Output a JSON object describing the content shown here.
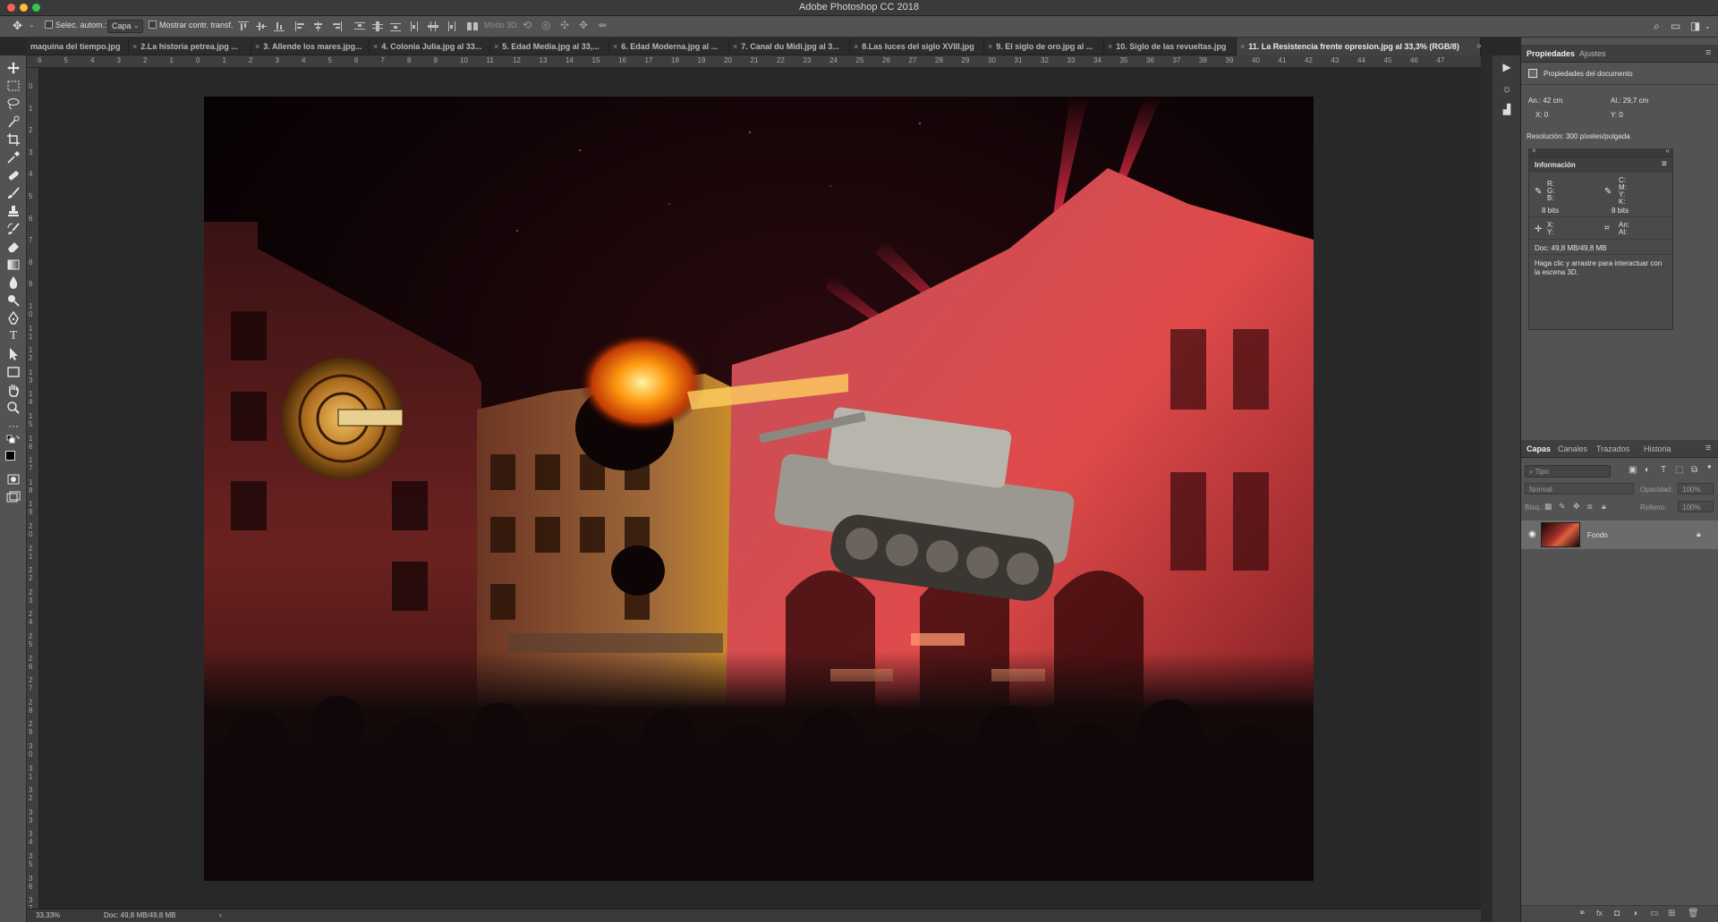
{
  "window": {
    "title": "Adobe Photoshop CC 2018",
    "traffic_colors": [
      "#fc605c",
      "#fdbc40",
      "#34c84a"
    ]
  },
  "options_bar": {
    "auto_select_label": "Selec. autom.:",
    "auto_select_value": "Capa",
    "show_transform_label": "Mostrar contr. transf.",
    "mode_3d_label": "Modo 3D:"
  },
  "tabs": [
    {
      "label": "maquina del tiempo.jpg",
      "close": ""
    },
    {
      "label": "2.La historia petrea.jpg ...",
      "close": "×"
    },
    {
      "label": "3. Allende los mares.jpg...",
      "close": "×"
    },
    {
      "label": "4. Colonia Julia.jpg al 33...",
      "close": "×"
    },
    {
      "label": "5. Edad Media.jpg al 33,...",
      "close": "×"
    },
    {
      "label": "6. Edad Moderna.jpg al ...",
      "close": "×"
    },
    {
      "label": "7. Canal du Midi.jpg al 3...",
      "close": "×"
    },
    {
      "label": "8.Las luces del siglo XVIII.jpg",
      "close": "×"
    },
    {
      "label": "9. El siglo de oro.jpg al ...",
      "close": "×"
    },
    {
      "label": "10. Siglo de las revueltas.jpg",
      "close": "×"
    },
    {
      "label": "11. La Resistencia frente opresion.jpg al 33,3% (RGB/8)",
      "close": "×"
    }
  ],
  "tab_overflow": "»",
  "rulers": {
    "top": [
      "6",
      "5",
      "4",
      "3",
      "2",
      "1",
      "0",
      "1",
      "2",
      "3",
      "4",
      "5",
      "6",
      "7",
      "8",
      "9",
      "10",
      "11",
      "12",
      "13",
      "14",
      "15",
      "16",
      "17",
      "18",
      "19",
      "20",
      "21",
      "22",
      "23",
      "24",
      "25",
      "26",
      "27",
      "28",
      "29",
      "30",
      "31",
      "32",
      "33",
      "34",
      "35",
      "36",
      "37",
      "38",
      "39",
      "40",
      "41",
      "42",
      "43",
      "44",
      "45",
      "46",
      "47"
    ],
    "left": [
      "0",
      "1",
      "2",
      "3",
      "4",
      "5",
      "6",
      "7",
      "8",
      "9",
      "1 0",
      "1 1",
      "1 2",
      "1 3",
      "1 4",
      "1 5",
      "1 6",
      "1 7",
      "1 8",
      "1 9",
      "2 0",
      "2 1",
      "2 2",
      "2 3",
      "2 4",
      "2 5",
      "2 6",
      "2 7",
      "2 8",
      "2 9",
      "3 0",
      "3 1",
      "3 2",
      "3 3",
      "3 4",
      "3 5",
      "3 6",
      "3 7"
    ]
  },
  "status_bar": {
    "zoom": "33,33%",
    "doc": "Doc: 49,8 MB/49,8 MB",
    "arrow": "›"
  },
  "properties_panel": {
    "tabs": [
      "Propiedades",
      "Ajustes"
    ],
    "section_title": "Propiedades del documento",
    "width_label": "An.:",
    "width_value": "42 cm",
    "height_label": "Al.:",
    "height_value": "29,7 cm",
    "x_label": "X:",
    "x_value": "0",
    "y_label": "Y:",
    "y_value": "0",
    "resolution": "Resolución: 300 píxeles/pulgada"
  },
  "info_panel": {
    "title": "Información",
    "rgb_labels": [
      "R:",
      "G:",
      "B:"
    ],
    "cmyk_labels": [
      "C:",
      "M:",
      "Y:",
      "K:"
    ],
    "bits_left": "8 bits",
    "bits_right": "8 bits",
    "xy_labels": [
      "X:",
      "Y:"
    ],
    "size_labels": [
      "An:",
      "Al:"
    ],
    "doc": "Doc: 49,8 MB/49,8 MB",
    "hint": "Haga clic y arrastre para interactuar con la escena 3D."
  },
  "layers_panel": {
    "tabs": [
      "Capas",
      "Canales",
      "Trazados",
      "Historia"
    ],
    "filter_placeholder": "Tipo",
    "blend_mode": "Normal",
    "opacity_label": "Opacidad:",
    "opacity_value": "100%",
    "lock_label": "Bloq.:",
    "fill_label": "Relleno:",
    "fill_value": "100%",
    "layers": [
      {
        "name": "Fondo",
        "visible": true,
        "locked": true
      }
    ]
  }
}
